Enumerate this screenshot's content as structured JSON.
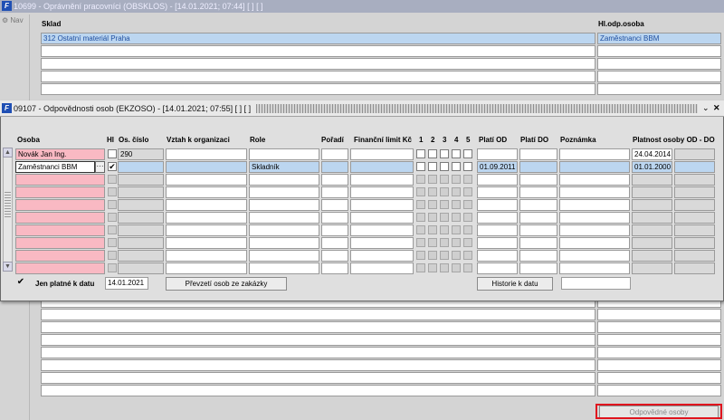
{
  "back_window": {
    "title": "10699 - Oprávnění pracovníci (OBSKLOS) - [14.01.2021; 07:44] [ ] [ ]",
    "nav_label": "Nav",
    "col_sklad": "Sklad",
    "col_hlodp": "Hl.odp.osoba",
    "row1_sklad": "312 Ostatní materiál Praha",
    "row1_osoba": "Zaměstnanci BBM",
    "odpovedne_button": "Odpovědné osoby"
  },
  "front_window": {
    "title": "09107 - Odpovědnosti osob (EKZOSO) - [14.01.2021; 07:55] [ ] [ ]",
    "headers": {
      "osoba": "Osoba",
      "hl": "Hl",
      "os_cislo": "Os. číslo",
      "vztah": "Vztah k organizaci",
      "role": "Role",
      "poradi": "Pořadí",
      "limit": "Finanční limit Kč",
      "c1": "1",
      "c2": "2",
      "c3": "3",
      "c4": "4",
      "c5": "5",
      "plati_od": "Platí OD",
      "plati_do": "Platí DO",
      "poznamka": "Poznámka",
      "platnost": "Platnost osoby OD - DO"
    },
    "row1": {
      "osoba": "Novák Jan Ing.",
      "os_cislo": "290",
      "platnost_od": "24.04.2014"
    },
    "row2": {
      "osoba": "Zaměstnanci BBM",
      "lov": "···",
      "hl_check": "✔",
      "role": "Skladník",
      "plati_od": "01.09.2011",
      "platnost_od": "01.01.2000"
    },
    "footer": {
      "check": "✔",
      "jen_platne": "Jen platné k datu",
      "date": "14.01.2021",
      "prevzeti_button": "Převzetí osob ze zakázky",
      "historie_button": "Historie k datu"
    },
    "scroll_up": "▲",
    "scroll_down": "▼",
    "minimize_icon": "⌄",
    "close_icon": "✕"
  }
}
